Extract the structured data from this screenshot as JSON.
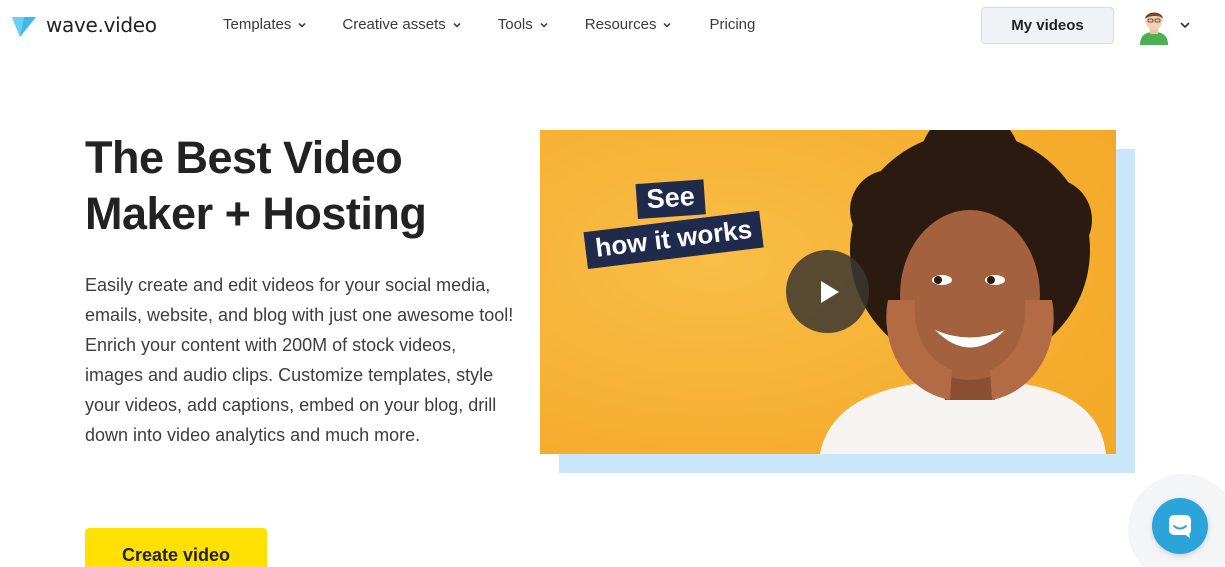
{
  "brand": {
    "name": "wave.video",
    "accent": "#2aa4d9"
  },
  "nav": {
    "items": [
      {
        "label": "Templates",
        "has_dropdown": true
      },
      {
        "label": "Creative assets",
        "has_dropdown": true
      },
      {
        "label": "Tools",
        "has_dropdown": true
      },
      {
        "label": "Resources",
        "has_dropdown": true
      },
      {
        "label": "Pricing",
        "has_dropdown": false
      }
    ]
  },
  "header": {
    "my_videos_label": "My videos",
    "avatar_icon": "user-avatar-icon"
  },
  "hero": {
    "title_line1": "The Best Video",
    "title_line2": "Maker + Hosting",
    "paragraph1": "Easily create and edit videos for your social media, emails, website, and blog with just one awesome tool!",
    "paragraph2": "Enrich your content with 200M of stock videos, images and audio clips. Customize templates, style your videos, add captions, embed on your blog, drill down into video analytics and much more.",
    "cta_label": "Create video",
    "cta_color": "#ffe100"
  },
  "video": {
    "tag_line1": "See",
    "tag_line2": "how it works",
    "background_color": "#f7b236",
    "shadow_color": "#c9e6fb",
    "play_icon": "play-icon"
  },
  "chat": {
    "icon": "chat-icon",
    "color": "#2aa4d9"
  }
}
